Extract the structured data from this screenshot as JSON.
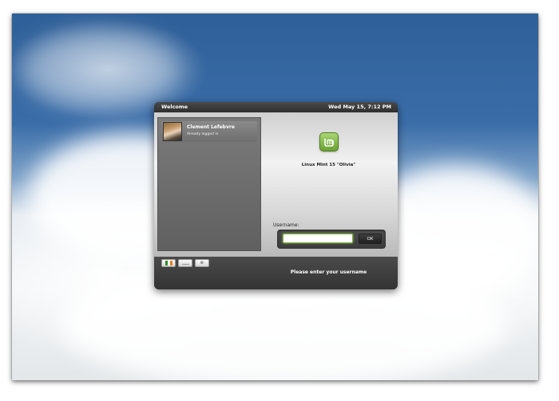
{
  "titlebar": {
    "title": "Welcome",
    "datetime": "Wed May 15, 7:12 PM"
  },
  "users": [
    {
      "name": "Clement Lefebvre",
      "status": "Already logged in"
    }
  ],
  "branding": {
    "os_name": "Linux Mint 15 \"Olivia\"",
    "logo_icon": "linux-mint-logo-icon",
    "logo_color": "#87c04a"
  },
  "login": {
    "username_label": "Username:",
    "username_value": "",
    "ok_label": "OK",
    "prompt": "Please enter your username"
  },
  "bottom_buttons": {
    "language_icon": "flag-ireland-icon",
    "session_icon": "session-icon",
    "power_label": "⚙",
    "power_icon": "gear-icon"
  },
  "colors": {
    "sky_top": "#2f5f98",
    "panel_dark": "#3c3c3c",
    "input_focus": "#7ab03b"
  }
}
